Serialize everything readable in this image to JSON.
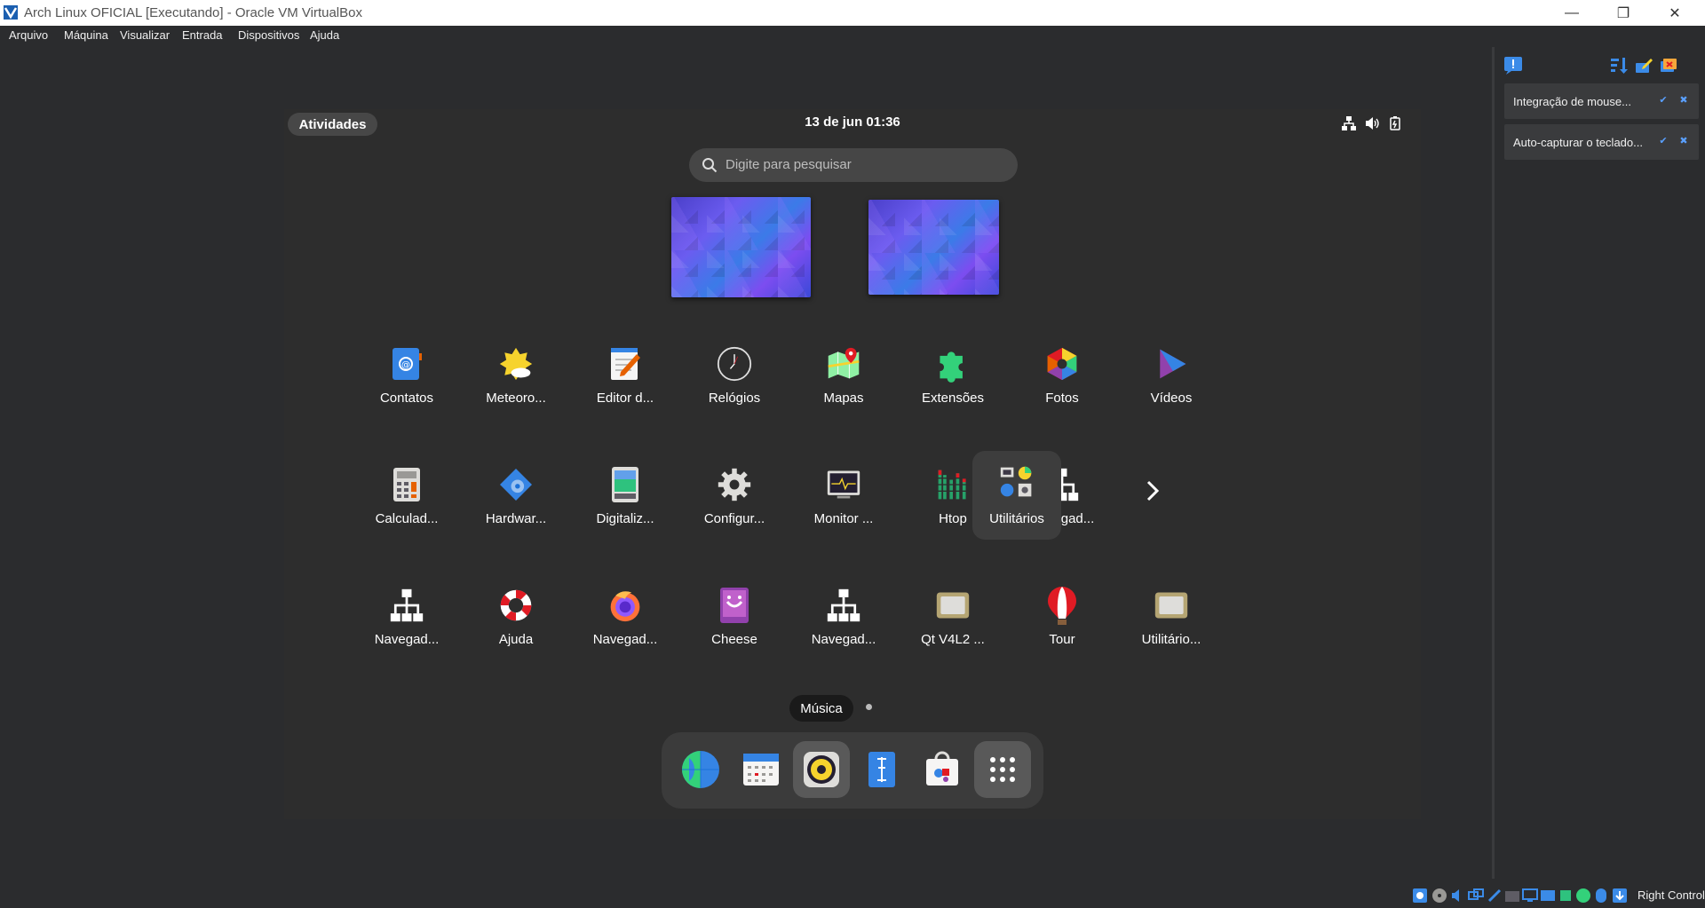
{
  "window": {
    "title": "Arch Linux OFICIAL [Executando] - Oracle VM VirtualBox",
    "minimize": "—",
    "restore": "❐",
    "close": "✕"
  },
  "menu": [
    "Arquivo",
    "Máquina",
    "Visualizar",
    "Entrada",
    "Dispositivos",
    "Ajuda"
  ],
  "guest": {
    "activities": "Atividades",
    "clock": "13 de jun  01:36",
    "search_placeholder": "Digite para pesquisar",
    "apps_row1": [
      "Contatos",
      "Meteoro...",
      "Editor d...",
      "Relógios",
      "Mapas",
      "Extensões",
      "Fotos",
      "Vídeos"
    ],
    "apps_row2": [
      "Calculad...",
      "Hardwar...",
      "Digitaliz...",
      "Configur...",
      "Monitor ...",
      "Htop",
      "Navegad...",
      "Utilitários"
    ],
    "apps_row3": [
      "Navegad...",
      "Ajuda",
      "Navegad...",
      "Cheese",
      "Navegad...",
      "Qt V4L2 ...",
      "Tour",
      "Utilitário..."
    ],
    "tooltip": "Música"
  },
  "notifications": [
    "Integração de mouse...",
    "Auto-capturar o teclado..."
  ],
  "statusbar": {
    "host_key": "Right Control"
  },
  "colors": {
    "guest_bg": "#2d2d2d",
    "host_bg": "#2b2c2e",
    "accent": "#3584e4"
  }
}
